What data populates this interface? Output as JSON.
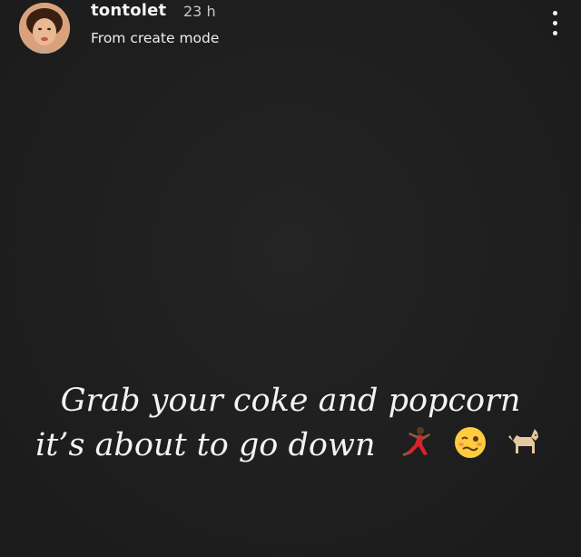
{
  "post": {
    "username": "tontolet",
    "time_ago": "23 h",
    "subtitle": "From create mode"
  },
  "caption": {
    "line1": "Grab your coke and popcorn",
    "line2": "it’s about to go down"
  },
  "emojis": [
    "dancing-woman-icon",
    "woozy-face-icon",
    "dog-icon"
  ],
  "colors": {
    "background": "#1f1f1f",
    "text": "#f3f3f3",
    "muted": "#c8c8c8"
  }
}
